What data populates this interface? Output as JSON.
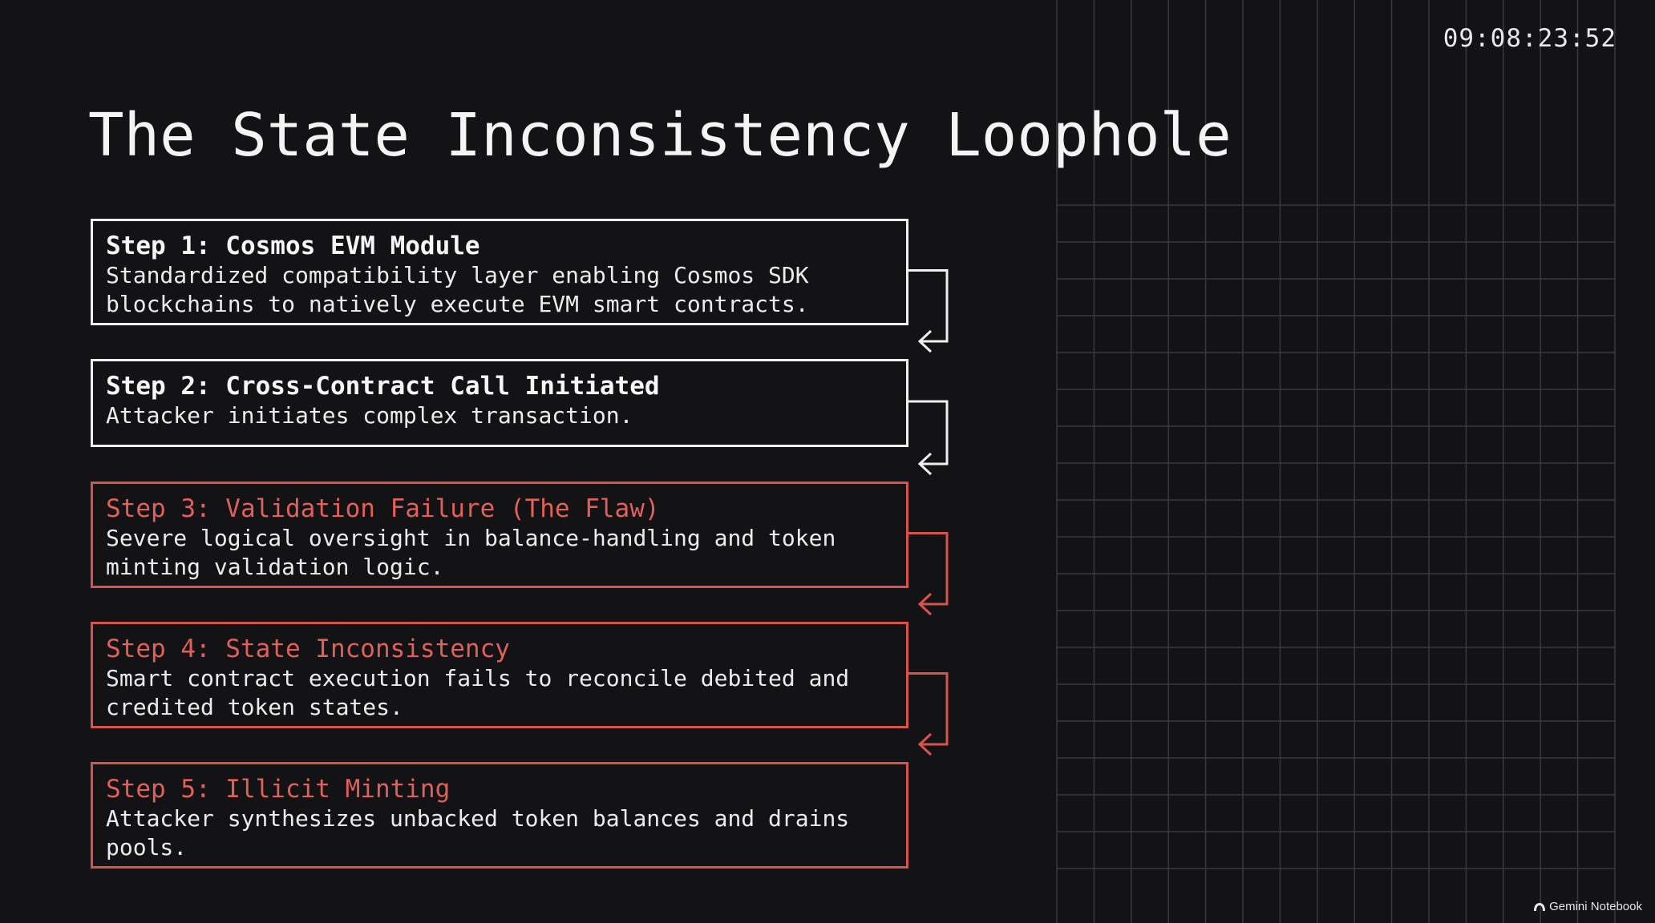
{
  "timestamp": "09:08:23:52",
  "title": "The State Inconsistency Loophole",
  "colors": {
    "background": "#131316",
    "normal_border": "#f0f0f0",
    "flaw_border": "#d9534d",
    "flaw_text": "#e0605a",
    "grid_line": "#3a3a3e"
  },
  "steps": [
    {
      "title": "Step 1: Cosmos EVM Module",
      "description": "Standardized compatibility layer enabling Cosmos SDK\nblockchains to natively execute EVM smart contracts.",
      "kind": "normal"
    },
    {
      "title": "Step 2: Cross-Contract Call Initiated",
      "description": "Attacker initiates complex transaction.",
      "kind": "normal"
    },
    {
      "title": "Step 3: Validation Failure (The Flaw)",
      "description": "Severe logical oversight in balance-handling and token\nminting validation logic.",
      "kind": "flaw"
    },
    {
      "title": "Step 4: State Inconsistency",
      "description": "Smart contract execution fails to reconcile debited and\ncredited token states.",
      "kind": "flaw"
    },
    {
      "title": "Step 5: Illicit Minting",
      "description": "Attacker synthesizes unbacked token balances and drains\npools.",
      "kind": "flaw"
    }
  ],
  "brand": {
    "label": "Gemini Notebook",
    "icon": "notebook-logo-icon"
  }
}
